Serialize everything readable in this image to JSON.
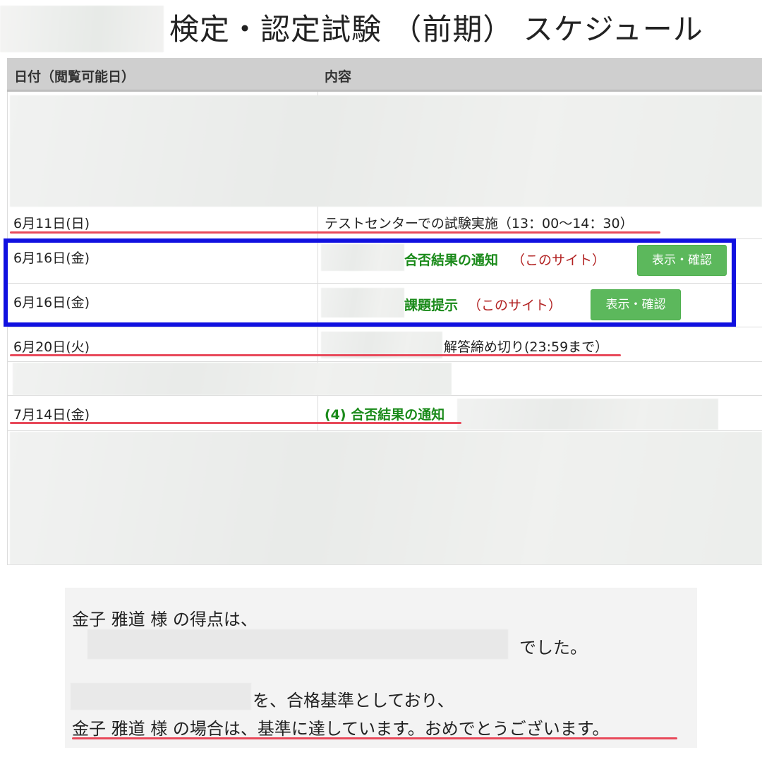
{
  "page": {
    "title": "検定・認定試験 （前期） スケジュール"
  },
  "table": {
    "headers": [
      "日付（閲覧可能日）",
      "内容"
    ],
    "rows": [
      {
        "date": "6月11日(日)",
        "content": "テストセンターでの試験実施（13：00〜14：30）"
      },
      {
        "date": "6月16日(金)",
        "content_green": "合否結果の通知",
        "content_red": "（このサイト）",
        "button": "表示・確認"
      },
      {
        "date": "6月16日(金)",
        "content_green": "課題提示",
        "content_red": "（このサイト）",
        "button": "表示・確認"
      },
      {
        "date": "6月20日(火)",
        "content": "解答締め切り(23:59まで）"
      },
      {
        "date": "7月14日(金)",
        "content_green": "(4) 合否結果の通知"
      }
    ]
  },
  "result": {
    "line1": "金子 雅道 様 の得点は、",
    "line2_suffix": "でした。",
    "line3_suffix": "を、合格基準としており、",
    "line4": "金子 雅道 様 の場合は、基準に達しています。おめでとうございます。"
  },
  "colors": {
    "header_bg": "#cfcfcf",
    "accent_green": "#1a8a1a",
    "button_green": "#5cb85c",
    "link_red": "#b22222",
    "highlight_blue": "#1010e0",
    "underline_red": "#e8495a"
  }
}
